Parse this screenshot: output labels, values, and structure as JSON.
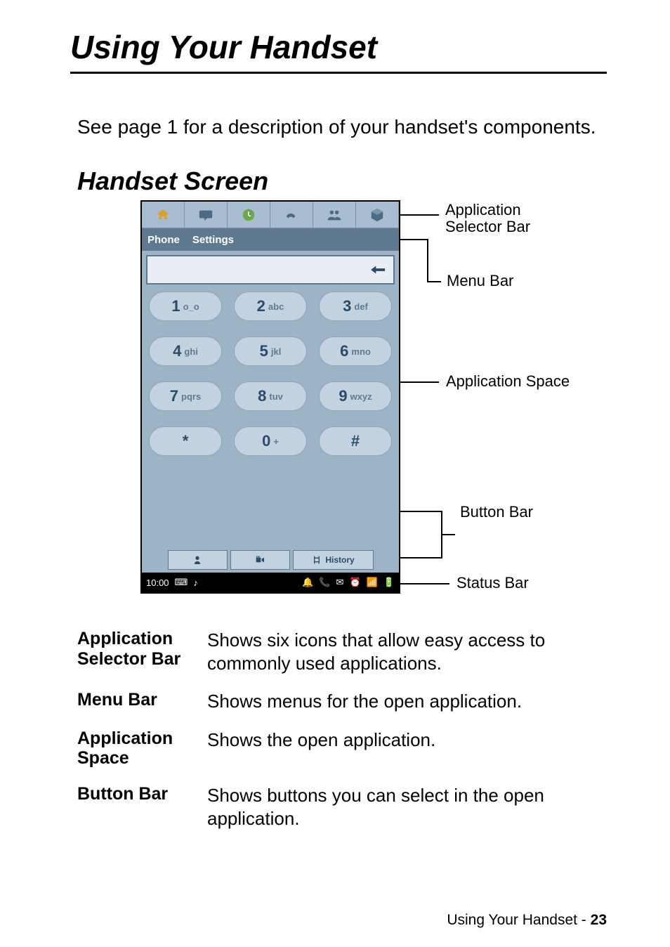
{
  "title": "Using Your Handset",
  "intro": "See page 1 for a description of your handset's components.",
  "section": "Handset Screen",
  "labels": {
    "app_selector": "Application\nSelector Bar",
    "menu_bar": "Menu Bar",
    "app_space": "Application Space",
    "button_bar": "Button Bar",
    "status_bar": "Status Bar"
  },
  "phone": {
    "menubar": {
      "phone": "Phone",
      "settings": "Settings"
    },
    "keys": [
      [
        {
          "n": "1",
          "s": "o_o"
        },
        {
          "n": "2",
          "s": "abc"
        },
        {
          "n": "3",
          "s": "def"
        }
      ],
      [
        {
          "n": "4",
          "s": "ghi"
        },
        {
          "n": "5",
          "s": "jkl"
        },
        {
          "n": "6",
          "s": "mno"
        }
      ],
      [
        {
          "n": "7",
          "s": "pqrs"
        },
        {
          "n": "8",
          "s": "tuv"
        },
        {
          "n": "9",
          "s": "wxyz"
        }
      ],
      [
        {
          "n": "*",
          "s": ""
        },
        {
          "n": "0",
          "s": "+"
        },
        {
          "n": "#",
          "s": ""
        }
      ]
    ],
    "history_btn": "History",
    "status_time": "10:00"
  },
  "defs": [
    {
      "term": "Application Selector Bar",
      "desc": "Shows six icons that allow easy access to commonly used applications."
    },
    {
      "term": "Menu Bar",
      "desc": "Shows menus for the open application."
    },
    {
      "term": "Application Space",
      "desc": "Shows the open application."
    },
    {
      "term": "Button Bar",
      "desc": "Shows buttons you can select in the open application."
    }
  ],
  "footer": {
    "text": "Using Your Handset - ",
    "page": "23"
  }
}
